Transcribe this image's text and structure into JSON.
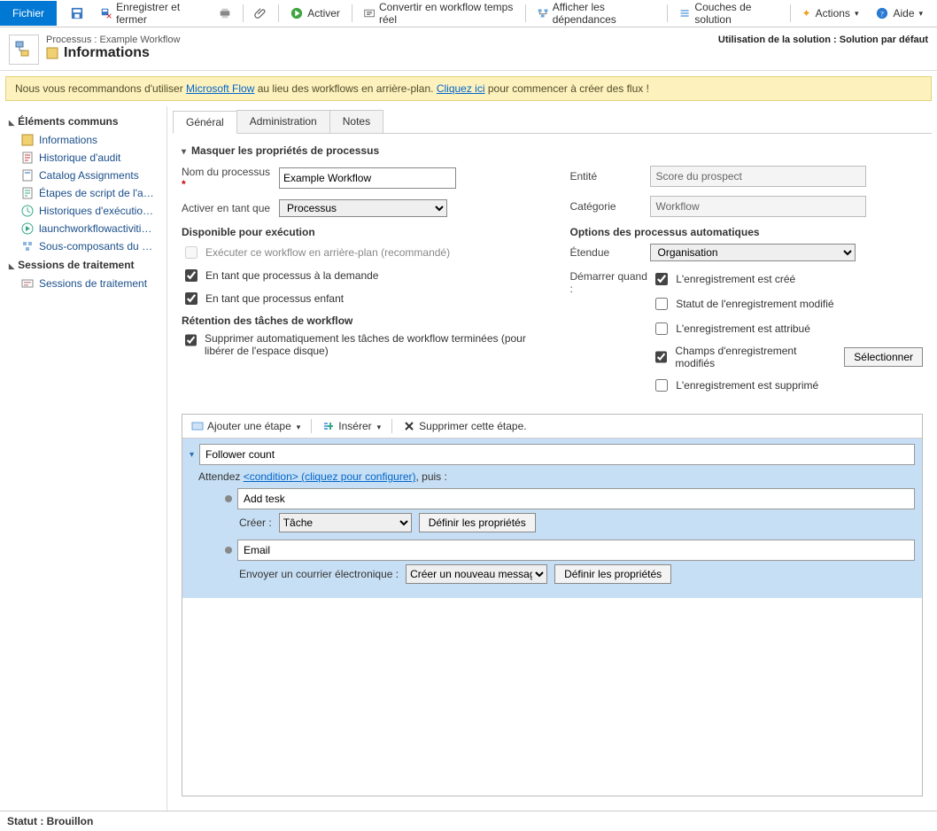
{
  "toolbar": {
    "file": "Fichier",
    "save_close": "Enregistrer et fermer",
    "activate": "Activer",
    "convert": "Convertir en workflow temps réel",
    "deps": "Afficher les dépendances",
    "layers": "Couches de solution",
    "actions": "Actions",
    "help": "Aide"
  },
  "header": {
    "crumb": "Processus : Example Workflow",
    "title": "Informations",
    "solution": "Utilisation de la solution : Solution par défaut"
  },
  "banner": {
    "pre": "Nous vous recommandons d'utiliser ",
    "link1": "Microsoft Flow",
    "mid": " au lieu des workflows en arrière-plan. ",
    "link2": "Cliquez ici",
    "post": " pour commencer à créer des flux !"
  },
  "sidebar": {
    "group1": "Éléments communs",
    "items1": [
      "Informations",
      "Historique d'audit",
      "Catalog Assignments",
      "Étapes de script de l'a…",
      "Historiques d'exécutio…",
      "launchworkflowactiviti…",
      "Sous-composants du …"
    ],
    "group2": "Sessions de traitement",
    "items2": [
      "Sessions de traitement"
    ]
  },
  "tabs": {
    "t0": "Général",
    "t1": "Administration",
    "t2": "Notes"
  },
  "form": {
    "section_toggle": "Masquer les propriétés de processus",
    "name_label": "Nom du processus",
    "name_value": "Example Workflow",
    "activate_as_label": "Activer en tant que",
    "activate_as_option": "Processus",
    "entity_label": "Entité",
    "entity_value": "Score du prospect",
    "category_label": "Catégorie",
    "category_value": "Workflow",
    "avail_header": "Disponible pour exécution",
    "chk_bg": "Exécuter ce workflow en arrière-plan (recommandé)",
    "chk_demand": "En tant que processus à la demande",
    "chk_child": "En tant que processus enfant",
    "retention_header": "Rétention des tâches de workflow",
    "chk_retention": "Supprimer automatiquement les tâches de workflow terminées (pour libérer de l'espace disque)",
    "auto_header": "Options des processus automatiques",
    "scope_label": "Étendue",
    "scope_option": "Organisation",
    "start_label": "Démarrer quand :",
    "chk_created": "L'enregistrement est créé",
    "chk_status": "Statut de l'enregistrement modifié",
    "chk_assigned": "L'enregistrement est attribué",
    "chk_fields": "Champs d'enregistrement modifiés",
    "select_btn": "Sélectionner",
    "chk_deleted": "L'enregistrement est supprimé"
  },
  "builder": {
    "add_step": "Ajouter une étape",
    "insert": "Insérer",
    "delete": "Supprimer cette étape.",
    "root_title": "Follower count",
    "wait_pre": "Attendez ",
    "wait_cond": "<condition>  (cliquez pour configurer)",
    "wait_post": ", puis :",
    "sub1_title": "Add tesk",
    "sub1_action_label": "Créer :",
    "sub1_action_option": "Tâche",
    "prop_btn": "Définir les propriétés",
    "sub2_title": "Email",
    "sub2_action_label": "Envoyer un courrier électronique :",
    "sub2_action_option": "Créer un nouveau messag"
  },
  "status": "Statut : Brouillon"
}
